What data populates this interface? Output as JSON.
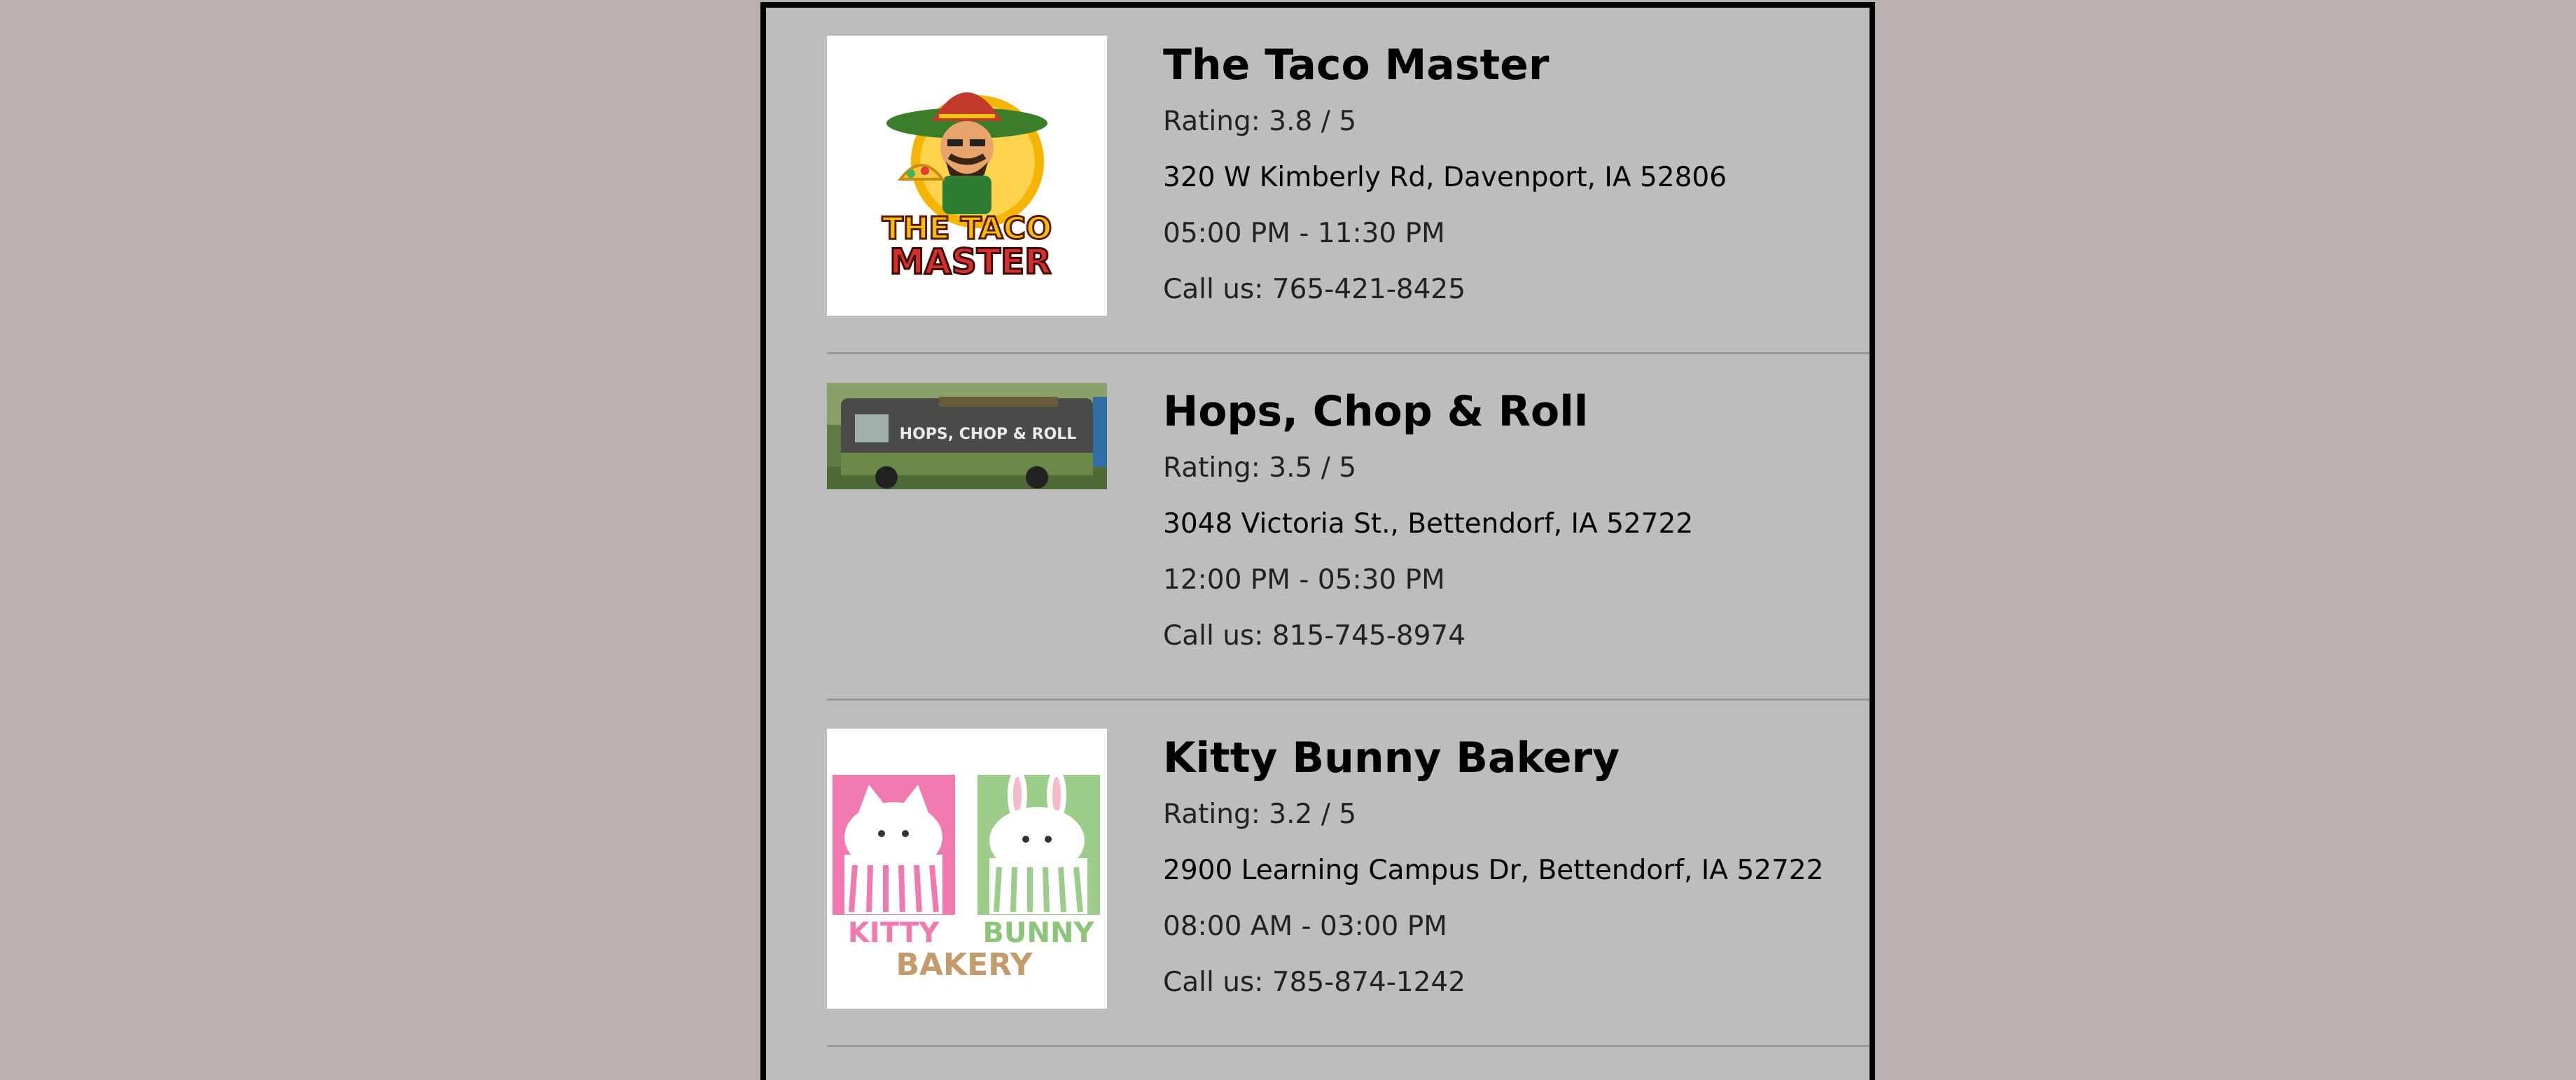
{
  "colors": {
    "page_background": "#b9b0b0",
    "panel_background": "#bdbdbd",
    "panel_border": "#000000",
    "divider": "#9a9a9a"
  },
  "trucks": [
    {
      "name": "The Taco Master",
      "rating": "Rating: 3.8 / 5",
      "address": "320 W Kimberly Rd, Davenport, IA 52806",
      "hours": "05:00 PM - 11:30 PM",
      "phone": "Call us: 765-421-8425",
      "logo": {
        "line1": "THE TACO",
        "line2": "MASTER"
      }
    },
    {
      "name": "Hops, Chop & Roll",
      "rating": "Rating: 3.5 / 5",
      "address": "3048 Victoria St., Bettendorf, IA 52722",
      "hours": "12:00 PM - 05:30 PM",
      "phone": "Call us: 815-745-8974",
      "logo": {
        "line1": "HOPS, CHOP & ROLL"
      }
    },
    {
      "name": "Kitty Bunny Bakery",
      "rating": "Rating: 3.2 / 5",
      "address": "2900 Learning Campus Dr, Bettendorf, IA 52722",
      "hours": "08:00 AM - 03:00 PM",
      "phone": "Call us: 785-874-1242",
      "logo": {
        "word1": "KITTY",
        "word2": "BUNNY",
        "word3": "BAKERY"
      }
    }
  ]
}
